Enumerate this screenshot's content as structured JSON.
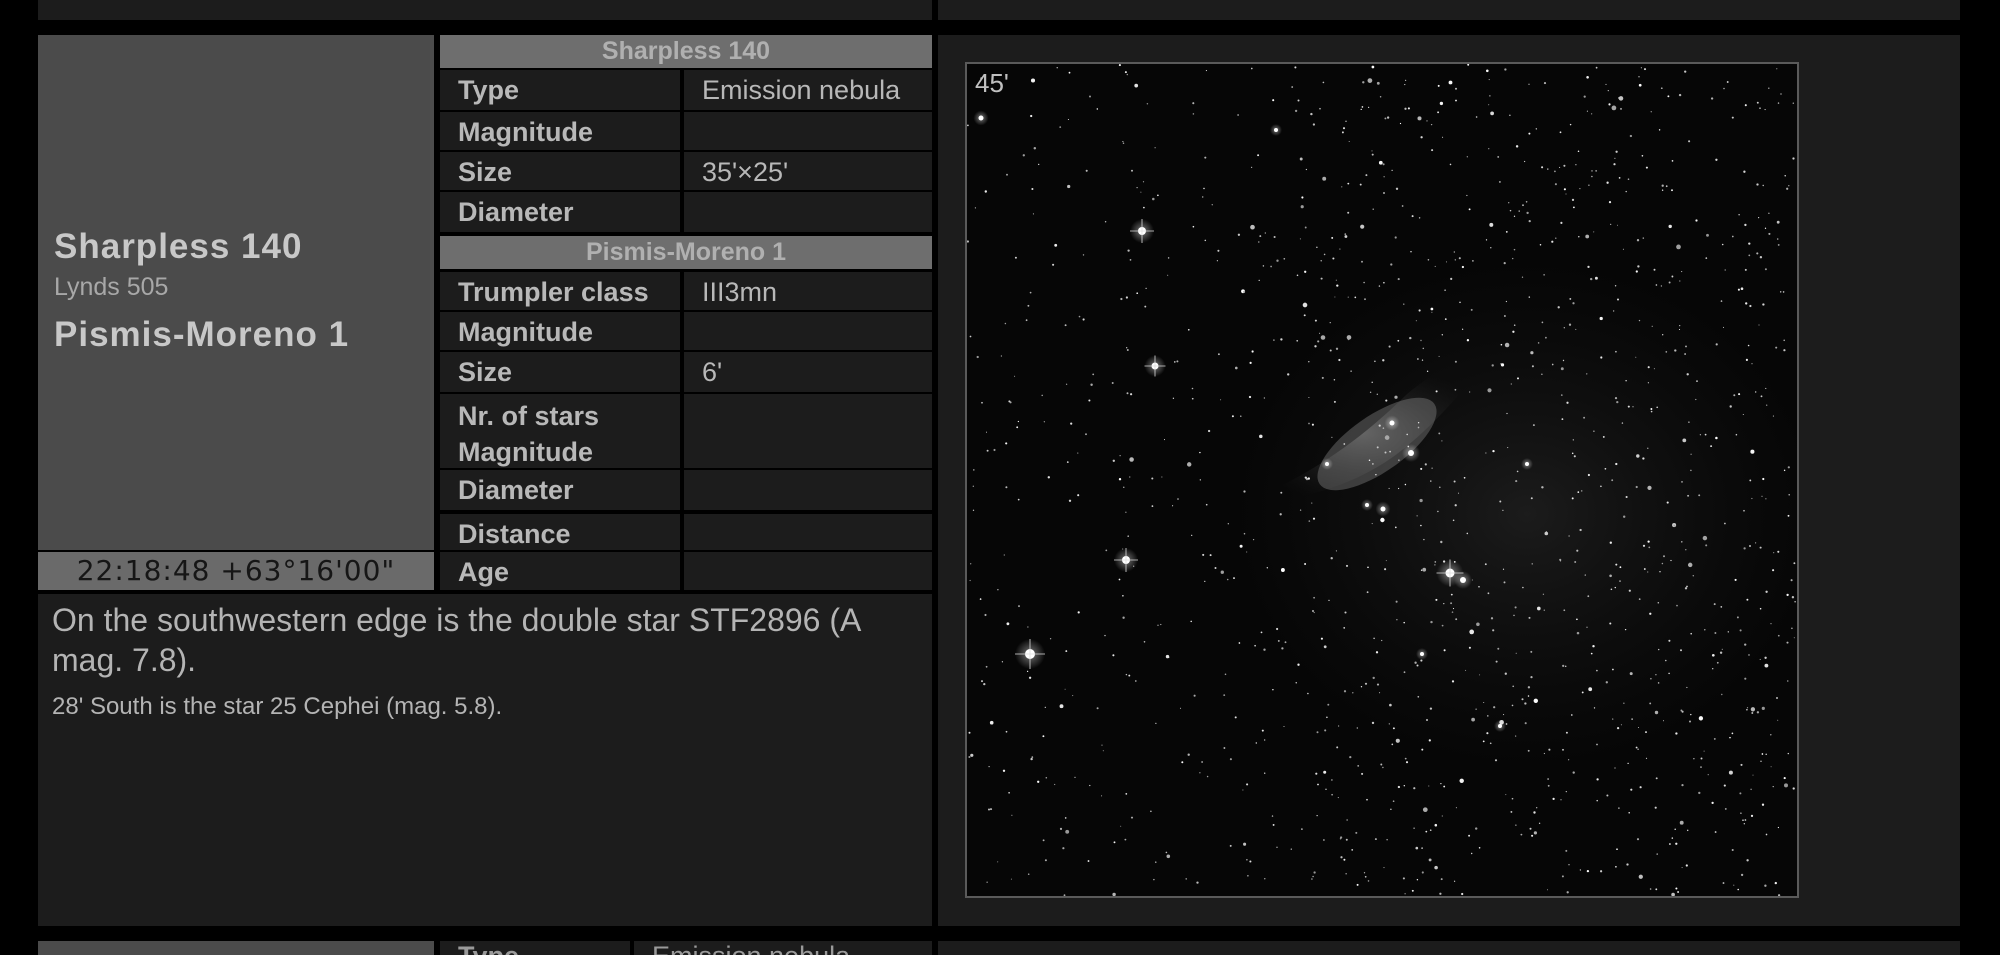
{
  "object": {
    "name_primary": "Sharpless 140",
    "name_alt": "Lynds 505",
    "name_secondary": "Pismis-Moreno 1",
    "coordinates": "22:18:48 +63°16'00\""
  },
  "nebula_table": {
    "title": "Sharpless 140",
    "rows": [
      {
        "label": "Type",
        "value": "Emission nebula"
      },
      {
        "label": "Magnitude",
        "value": ""
      },
      {
        "label": "Size",
        "value": "35'×25'"
      },
      {
        "label": "Diameter",
        "value": ""
      }
    ]
  },
  "cluster_table": {
    "title": "Pismis-Moreno 1",
    "rows": [
      {
        "label": "Trumpler class",
        "value": "III3mn"
      },
      {
        "label": "Magnitude",
        "value": ""
      },
      {
        "label": "Size",
        "value": "6'"
      },
      {
        "label": "Nr. of stars",
        "label2": "Magnitude",
        "value": ""
      },
      {
        "label": "Diameter",
        "value": ""
      },
      {
        "label": "Distance",
        "value": ""
      },
      {
        "label": "Age",
        "value": ""
      }
    ]
  },
  "description": {
    "main": "On the southwestern edge is the double star STF2896 (A mag. 7.8).",
    "sub": "28' South is the star 25 Cephei (mag. 5.8)."
  },
  "image": {
    "scale_label": "45'"
  },
  "next_entry": {
    "first_label": "Type",
    "first_value": "Emission nebula"
  }
}
